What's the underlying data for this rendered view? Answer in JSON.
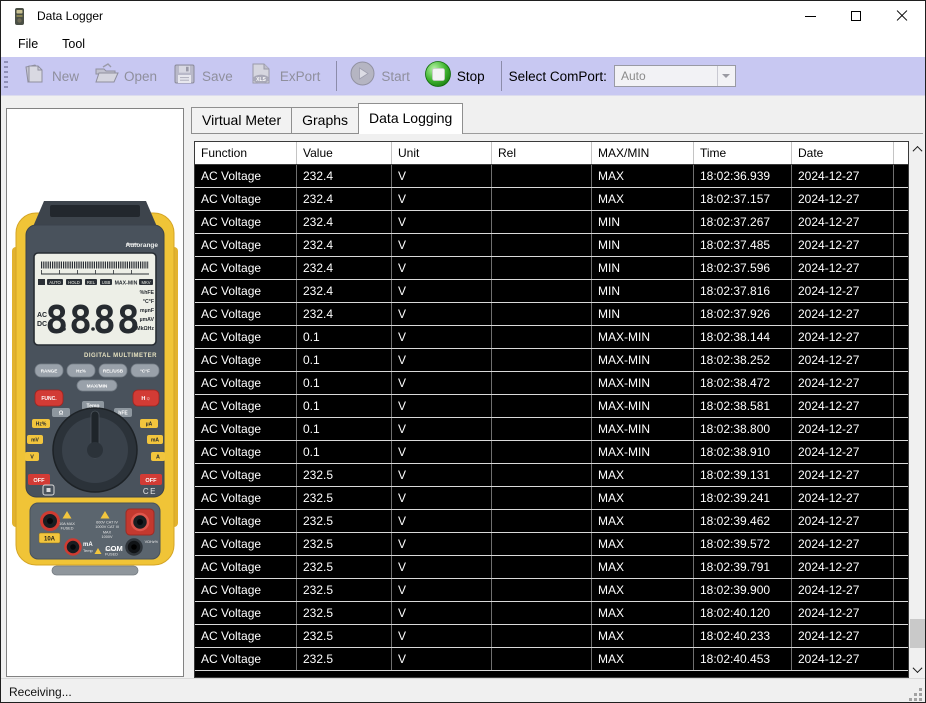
{
  "window": {
    "title": "Data Logger"
  },
  "menu": {
    "items": [
      {
        "label": "File"
      },
      {
        "label": "Tool"
      }
    ]
  },
  "toolbar": {
    "buttons": [
      {
        "label": "New",
        "enabled": false
      },
      {
        "label": "Open",
        "enabled": false
      },
      {
        "label": "Save",
        "enabled": false
      },
      {
        "label": "ExPort",
        "enabled": false,
        "badge": "XLS"
      },
      {
        "label": "Start",
        "enabled": false
      },
      {
        "label": "Stop",
        "enabled": true
      }
    ],
    "comport_label": "Select ComPort:",
    "comport_value": "Auto",
    "stop_color": "#2fae24"
  },
  "tabs": [
    {
      "label": "Virtual Meter",
      "active": false
    },
    {
      "label": "Graphs",
      "active": false
    },
    {
      "label": "Data Logging",
      "active": true
    }
  ],
  "table": {
    "columns": [
      "Function",
      "Value",
      "Unit",
      "Rel",
      "MAX/MIN",
      "Time",
      "Date"
    ],
    "rows": [
      [
        "AC Voltage",
        "232.4",
        "V",
        "",
        "MAX",
        "18:02:36.939",
        "2024-12-27"
      ],
      [
        "AC Voltage",
        "232.4",
        "V",
        "",
        "MAX",
        "18:02:37.157",
        "2024-12-27"
      ],
      [
        "AC Voltage",
        "232.4",
        "V",
        "",
        "MIN",
        "18:02:37.267",
        "2024-12-27"
      ],
      [
        "AC Voltage",
        "232.4",
        "V",
        "",
        "MIN",
        "18:02:37.485",
        "2024-12-27"
      ],
      [
        "AC Voltage",
        "232.4",
        "V",
        "",
        "MIN",
        "18:02:37.596",
        "2024-12-27"
      ],
      [
        "AC Voltage",
        "232.4",
        "V",
        "",
        "MIN",
        "18:02:37.816",
        "2024-12-27"
      ],
      [
        "AC Voltage",
        "232.4",
        "V",
        "",
        "MIN",
        "18:02:37.926",
        "2024-12-27"
      ],
      [
        "AC Voltage",
        "0.1",
        "V",
        "",
        "MAX-MIN",
        "18:02:38.144",
        "2024-12-27"
      ],
      [
        "AC Voltage",
        "0.1",
        "V",
        "",
        "MAX-MIN",
        "18:02:38.252",
        "2024-12-27"
      ],
      [
        "AC Voltage",
        "0.1",
        "V",
        "",
        "MAX-MIN",
        "18:02:38.472",
        "2024-12-27"
      ],
      [
        "AC Voltage",
        "0.1",
        "V",
        "",
        "MAX-MIN",
        "18:02:38.581",
        "2024-12-27"
      ],
      [
        "AC Voltage",
        "0.1",
        "V",
        "",
        "MAX-MIN",
        "18:02:38.800",
        "2024-12-27"
      ],
      [
        "AC Voltage",
        "0.1",
        "V",
        "",
        "MAX-MIN",
        "18:02:38.910",
        "2024-12-27"
      ],
      [
        "AC Voltage",
        "232.5",
        "V",
        "",
        "MAX",
        "18:02:39.131",
        "2024-12-27"
      ],
      [
        "AC Voltage",
        "232.5",
        "V",
        "",
        "MAX",
        "18:02:39.241",
        "2024-12-27"
      ],
      [
        "AC Voltage",
        "232.5",
        "V",
        "",
        "MAX",
        "18:02:39.462",
        "2024-12-27"
      ],
      [
        "AC Voltage",
        "232.5",
        "V",
        "",
        "MAX",
        "18:02:39.572",
        "2024-12-27"
      ],
      [
        "AC Voltage",
        "232.5",
        "V",
        "",
        "MAX",
        "18:02:39.791",
        "2024-12-27"
      ],
      [
        "AC Voltage",
        "232.5",
        "V",
        "",
        "MAX",
        "18:02:39.900",
        "2024-12-27"
      ],
      [
        "AC Voltage",
        "232.5",
        "V",
        "",
        "MAX",
        "18:02:40.120",
        "2024-12-27"
      ],
      [
        "AC Voltage",
        "232.5",
        "V",
        "",
        "MAX",
        "18:02:40.233",
        "2024-12-27"
      ],
      [
        "AC Voltage",
        "232.5",
        "V",
        "",
        "MAX",
        "18:02:40.453",
        "2024-12-27"
      ]
    ]
  },
  "status": {
    "text": "Receiving..."
  },
  "meter": {
    "autorange": "Autorange",
    "brand_line": "DIGITAL MULTIMETER",
    "lcd_digits": "8888",
    "lcd_ac": "AC",
    "lcd_dc": "DC",
    "lcd_indicators": [
      "AUTO",
      "HOLD",
      "REL",
      "USB",
      "MAX-MIN",
      "MKV"
    ],
    "lcd_units": [
      "%hFE",
      "°C°F",
      "mµnF",
      "µmAV",
      "MkΩHz"
    ],
    "buttons_row1": [
      "RANGE",
      "Hz%",
      "REL/USB",
      "°C°F"
    ],
    "button_maxmin": "MAX/MIN",
    "button_func": "FUNC.",
    "button_backlight": "H☼",
    "dial_top": [
      "Ω",
      "Temp",
      "hFE"
    ],
    "dial_left": [
      "Hz%",
      "mV",
      "V"
    ],
    "dial_right": [
      "µA",
      "mA",
      "A"
    ],
    "dial_off_left": "OFF",
    "dial_off_right": "OFF",
    "ce_mark": "CE",
    "jack_10a": "10A",
    "jack_10a_warn1": "10A MAX",
    "jack_10a_warn2": "FUSED",
    "jack_cat1": "600V CAT IV",
    "jack_cat2": "1000V CAT III",
    "jack_max1": "MAX",
    "jack_max2": "1000V",
    "jack_ma": "mA",
    "jack_temp": "Temp",
    "jack_com": "COM",
    "jack_fused1": "400mA",
    "jack_fused2": "FUSED",
    "jack_right": "VΩHz%",
    "body_color": "#f0c437",
    "face_color": "#49525c"
  }
}
